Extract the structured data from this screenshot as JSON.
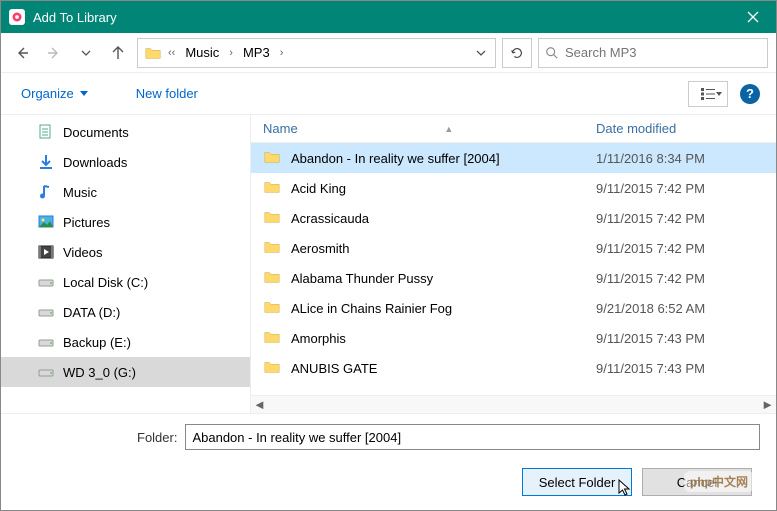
{
  "titlebar": {
    "title": "Add To Library"
  },
  "nav": {
    "breadcrumb": [
      "Music",
      "MP3"
    ],
    "search_placeholder": "Search MP3"
  },
  "toolbar": {
    "organize": "Organize",
    "new_folder": "New folder"
  },
  "tree": {
    "items": [
      {
        "key": "documents",
        "label": "Documents",
        "icon": "documents-icon"
      },
      {
        "key": "downloads",
        "label": "Downloads",
        "icon": "downloads-icon"
      },
      {
        "key": "music",
        "label": "Music",
        "icon": "music-icon"
      },
      {
        "key": "pictures",
        "label": "Pictures",
        "icon": "pictures-icon"
      },
      {
        "key": "videos",
        "label": "Videos",
        "icon": "videos-icon"
      },
      {
        "key": "localc",
        "label": "Local Disk (C:)",
        "icon": "drive-icon"
      },
      {
        "key": "datad",
        "label": "DATA (D:)",
        "icon": "drive-icon"
      },
      {
        "key": "backupe",
        "label": "Backup (E:)",
        "icon": "drive-icon"
      },
      {
        "key": "wdg",
        "label": "WD 3_0 (G:)",
        "icon": "drive-icon"
      }
    ],
    "selected": "wdg"
  },
  "columns": {
    "name": "Name",
    "date": "Date modified"
  },
  "files": {
    "selected": 0,
    "items": [
      {
        "name": "Abandon - In reality we suffer [2004]",
        "date": "1/11/2016 8:34 PM"
      },
      {
        "name": "Acid King",
        "date": "9/11/2015 7:42 PM"
      },
      {
        "name": "Acrassicauda",
        "date": "9/11/2015 7:42 PM"
      },
      {
        "name": "Aerosmith",
        "date": "9/11/2015 7:42 PM"
      },
      {
        "name": "Alabama Thunder Pussy",
        "date": "9/11/2015 7:42 PM"
      },
      {
        "name": "ALice in Chains Rainier Fog",
        "date": "9/21/2018 6:52 AM"
      },
      {
        "name": "Amorphis",
        "date": "9/11/2015 7:43 PM"
      },
      {
        "name": "ANUBIS GATE",
        "date": "9/11/2015 7:43 PM"
      }
    ]
  },
  "footer": {
    "folder_label": "Folder:",
    "folder_value": "Abandon - In reality we suffer [2004]",
    "select_btn": "Select Folder",
    "cancel_btn": "Cancel"
  },
  "watermark": "php中文网"
}
